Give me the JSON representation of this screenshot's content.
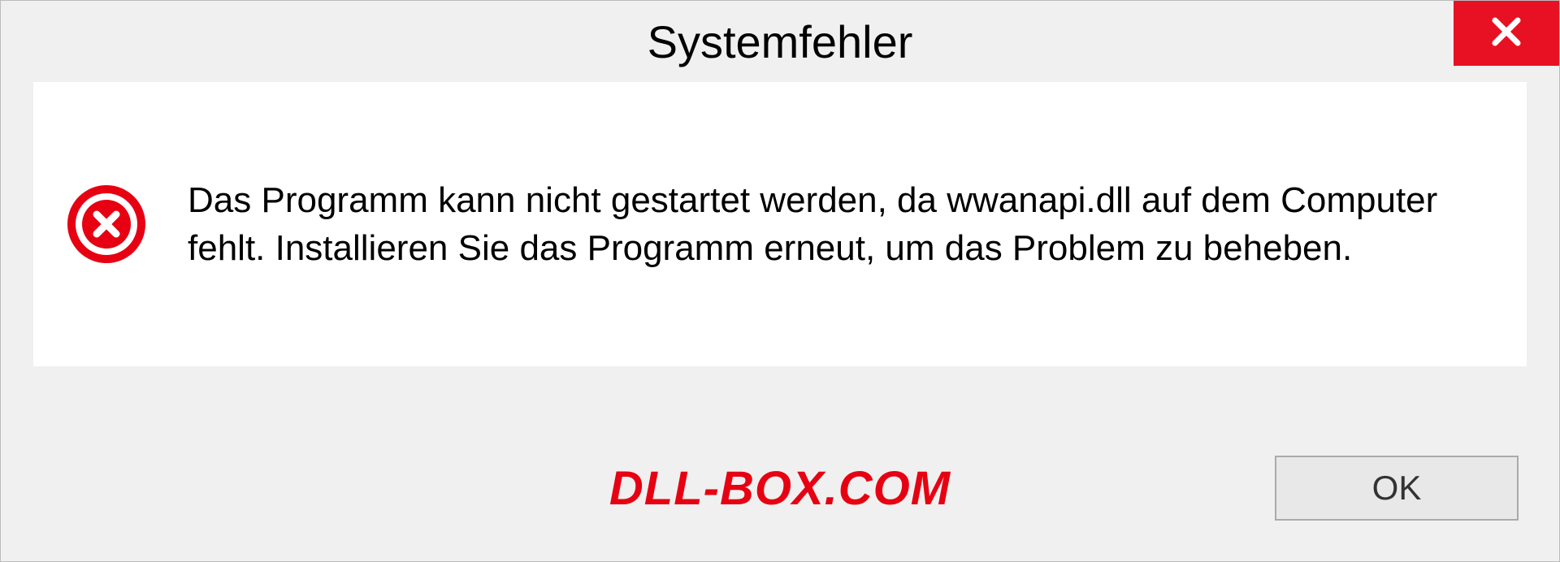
{
  "dialog": {
    "title": "Systemfehler",
    "message": "Das Programm kann nicht gestartet werden, da wwanapi.dll auf dem Computer fehlt. Installieren Sie das Programm erneut, um das Problem zu beheben.",
    "ok_label": "OK"
  },
  "watermark": "DLL-BOX.COM"
}
